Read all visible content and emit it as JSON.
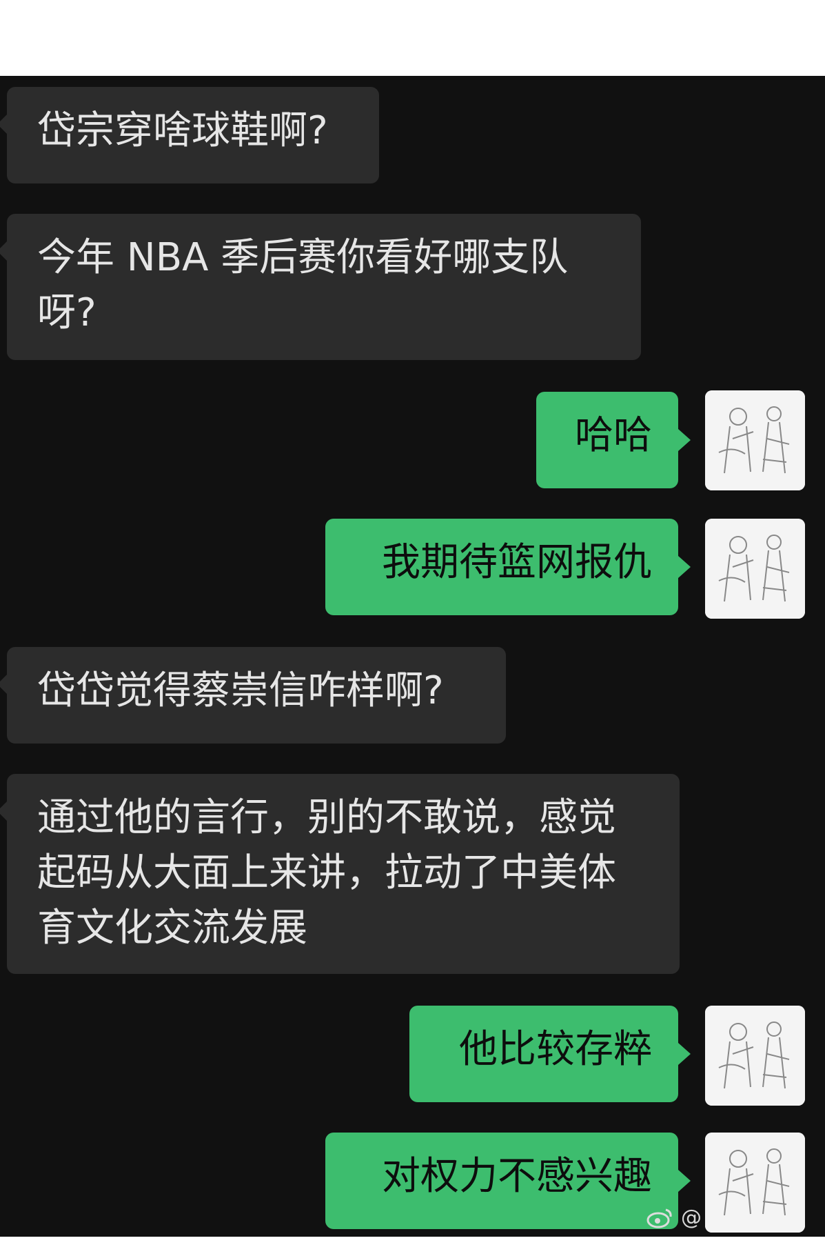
{
  "messages": [
    {
      "side": "left",
      "text": "岱宗穿啥球鞋啊?"
    },
    {
      "side": "left",
      "text": "今年 NBA 季后赛你看好哪支队\n呀?"
    },
    {
      "side": "right",
      "text": "哈哈"
    },
    {
      "side": "right",
      "text": "我期待篮网报仇"
    },
    {
      "side": "left",
      "text": "岱岱觉得蔡崇信咋样啊?"
    },
    {
      "side": "left",
      "text": "通过他的言行，别的不敢说，感觉\n起码从大面上来讲，拉动了中美体\n育文化交流发展"
    },
    {
      "side": "right",
      "text": "他比较存粹"
    },
    {
      "side": "right",
      "text": "对权力不感兴趣"
    }
  ],
  "watermark": {
    "text": "@"
  },
  "colors": {
    "chat_bg": "#111111",
    "left_bubble": "#2c2c2c",
    "right_bubble": "#3dbd6e"
  },
  "icons": {
    "avatar": "sketch-avatar-icon",
    "watermark": "weibo-logo-icon"
  }
}
